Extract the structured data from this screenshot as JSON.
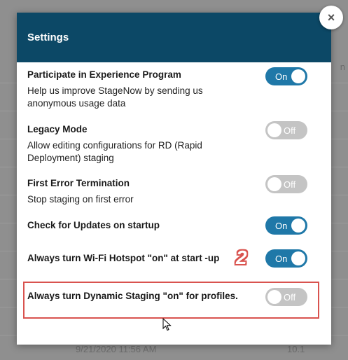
{
  "background": {
    "column_header_fragment": "n",
    "row_date": "9/21/2020 11:56 AM",
    "row_version": "10.1"
  },
  "dialog": {
    "title": "Settings",
    "close_glyph": "×",
    "header_color": "#0c4866"
  },
  "settings": [
    {
      "label": "Participate in Experience Program",
      "description": "Help us improve StageNow by sending us anonymous usage data",
      "toggle": "On",
      "state": "on"
    },
    {
      "label": "Legacy Mode",
      "description": "Allow editing configurations for RD (Rapid Deployment) staging",
      "toggle": "Off",
      "state": "off"
    },
    {
      "label": "First Error Termination",
      "description": "Stop staging on first error",
      "toggle": "Off",
      "state": "off"
    },
    {
      "label": "Check for Updates on startup",
      "description": "",
      "toggle": "On",
      "state": "on"
    },
    {
      "label": "Always turn Wi-Fi Hotspot \"on\" at start -up",
      "description": "",
      "toggle": "On",
      "state": "on"
    },
    {
      "label": "Always turn Dynamic Staging \"on\" for profiles.",
      "description": "",
      "toggle": "Off",
      "state": "off"
    }
  ],
  "annotation": {
    "step_number": "2",
    "highlight_color": "#d9534f"
  },
  "colors": {
    "toggle_on": "#1f78a8",
    "toggle_off": "#c4c4c4"
  }
}
